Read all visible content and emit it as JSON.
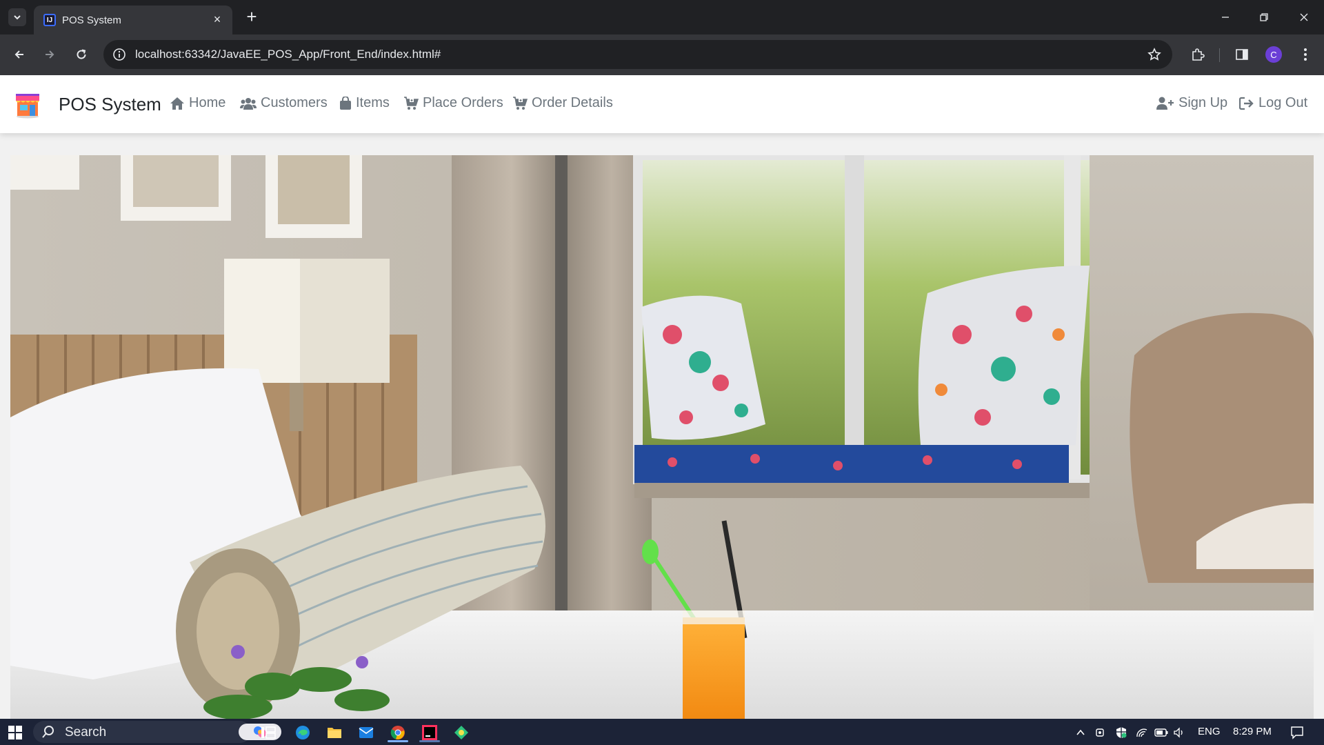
{
  "browser": {
    "tab_title": "POS System",
    "tab_favicon_text": "IJ",
    "url": "localhost:63342/JavaEE_POS_App/Front_End/index.html#",
    "profile_initial": "C"
  },
  "app": {
    "brand": "POS System",
    "nav": [
      {
        "label": "Home",
        "icon": "home-icon"
      },
      {
        "label": "Customers",
        "icon": "users-icon"
      },
      {
        "label": "Items",
        "icon": "bag-icon"
      },
      {
        "label": "Place Orders",
        "icon": "cart-icon"
      },
      {
        "label": "Order Details",
        "icon": "cart-icon"
      }
    ],
    "auth": [
      {
        "label": "Sign Up",
        "icon": "user-plus-icon"
      },
      {
        "label": "Log Out",
        "icon": "logout-icon"
      }
    ]
  },
  "taskbar": {
    "search_label": "Search",
    "language": "ENG",
    "time": "8:29 PM"
  },
  "colors": {
    "nav_text": "#6c757d",
    "brand_text": "#212529",
    "chrome_bg": "#202124",
    "taskbar_bg": "#1c2337"
  }
}
